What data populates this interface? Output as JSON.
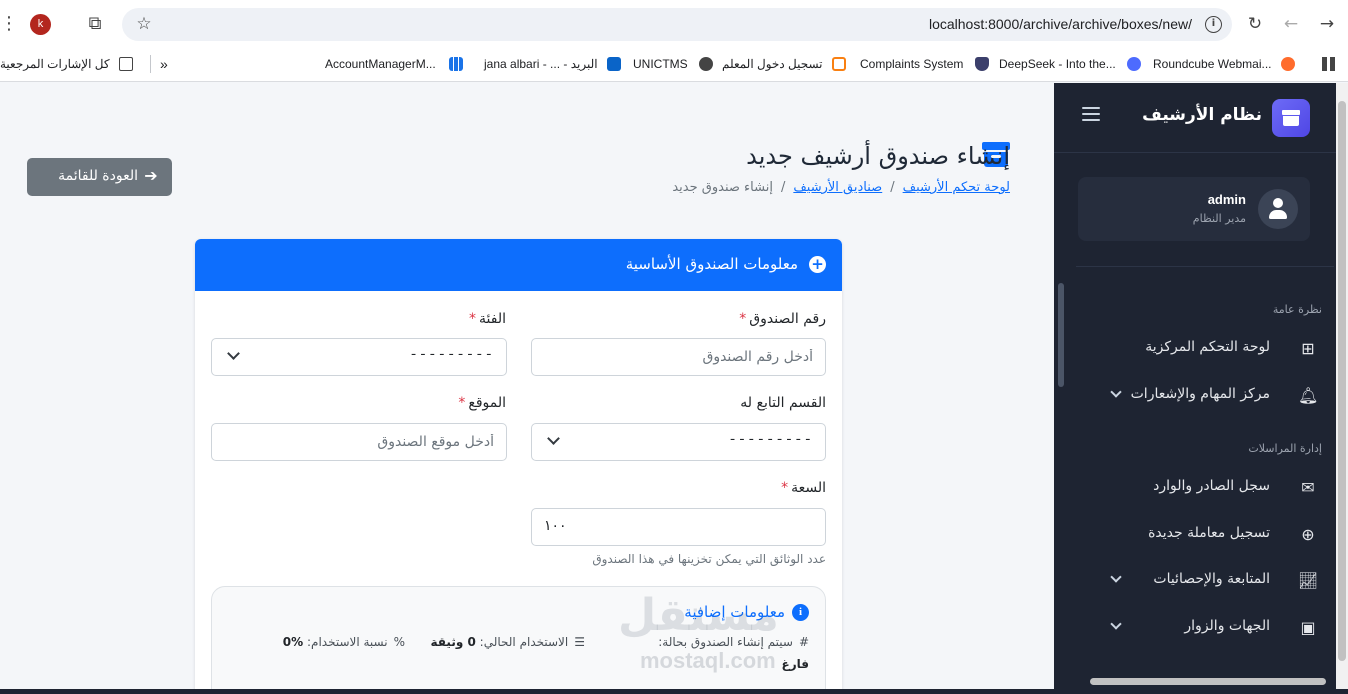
{
  "browser": {
    "profile_initial": "k",
    "url": "localhost:8000/archive/archive/boxes/new/",
    "bookmarks": [
      {
        "label": "كل الإشارات المرجعية",
        "icon": "folder-icon"
      },
      {
        "label": "AccountManagerM...",
        "icon": "bookmark-icon"
      },
      {
        "label": "jana albari - ... - البريد",
        "icon": "outlook-icon"
      },
      {
        "label": "UNICTMS",
        "icon": "globe-icon"
      },
      {
        "label": "تسجيل دخول المعلم",
        "icon": "moodle-icon"
      },
      {
        "label": "Complaints System",
        "icon": "shield-icon"
      },
      {
        "label": "DeepSeek - Into the...",
        "icon": "deepseek-icon"
      },
      {
        "label": "Roundcube Webmai...",
        "icon": "cpanel-icon"
      }
    ]
  },
  "sidebar": {
    "title": "نظام الأرشيف",
    "user": {
      "name": "admin",
      "role": "مدير النظام"
    },
    "sections": [
      {
        "label": "نظرة عامة"
      },
      {
        "label": "إدارة المراسلات"
      }
    ],
    "items": [
      {
        "label": "لوحة التحكم المركزية",
        "icon": "grid-icon"
      },
      {
        "label": "مركز المهام والإشعارات",
        "icon": "bell-icon"
      },
      {
        "label": "سجل الصادر والوارد",
        "icon": "envelope-icon"
      },
      {
        "label": "تسجيل معاملة جديدة",
        "icon": "plus-circle-icon"
      },
      {
        "label": "المتابعة والإحصائيات",
        "icon": "chart-line-icon"
      },
      {
        "label": "الجهات والزوار",
        "icon": "contact-book-icon"
      }
    ]
  },
  "page": {
    "title": "إنشاء صندوق أرشيف جديد",
    "breadcrumb": {
      "home": "لوحة تحكم الأرشيف",
      "boxes": "صناديق الأرشيف",
      "current": "إنشاء صندوق جديد"
    },
    "back_button": "العودة للقائمة"
  },
  "form": {
    "card_title": "معلومات الصندوق الأساسية",
    "box_number": {
      "label": "رقم الصندوق",
      "required": "*",
      "placeholder": "أدخل رقم الصندوق"
    },
    "category": {
      "label": "الفئة",
      "required": "*",
      "value": "---------"
    },
    "department": {
      "label": "القسم التابع له",
      "value": "---------"
    },
    "location": {
      "label": "الموقع",
      "required": "*",
      "placeholder": "أدخل موقع الصندوق"
    },
    "capacity": {
      "label": "السعة",
      "required": "*",
      "value": "١٠٠",
      "help": "عدد الوثائق التي يمكن تخزينها في هذا الصندوق"
    },
    "extra": {
      "title": "معلومات إضافية",
      "status_text": "سيتم إنشاء الصندوق بحالة:",
      "status_value": "فارغ",
      "usage_text": "الاستخدام الحالي:",
      "usage_value": "0 وثيقة",
      "ratio_text": "نسبة الاستخدام:",
      "ratio_value": "0%"
    }
  },
  "watermark": {
    "arabic": "مستقل",
    "latin": "mostaql.com"
  }
}
